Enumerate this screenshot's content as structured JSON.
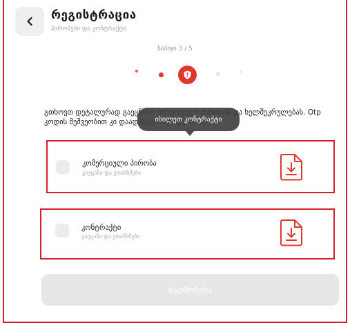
{
  "header": {
    "back_icon": "chevron-left-icon",
    "title": "რეგისტრაცია",
    "subtitle": "პირობები და კონტრაქტი"
  },
  "stepper": {
    "label": "ნაბიჯი 3 / 5",
    "current": 3,
    "total": 5,
    "active_icon": "shield-alert-icon",
    "accent_color": "#e0372d"
  },
  "description": "გთხოვთ დეტალურად გაეცნოთ კომერციულ პირობას და ხელშეკრულებას. Otp კოდის მეშვეობით კი დაადასტუროთ ხელმოწერა.",
  "tooltip": "ისილეთ კონტრაქტი",
  "documents": [
    {
      "title": "კომერციული პირობა",
      "subtitle": "გაეცანი და ეთანხმები",
      "icon": "file-download-icon",
      "checked": false
    },
    {
      "title": "კონტრაქტი",
      "subtitle": "გაეცანი და ეთანხმები",
      "icon": "file-download-icon",
      "checked": false
    }
  ],
  "actions": {
    "sign_label": "ხელმოწერა",
    "sign_enabled": false
  },
  "colors": {
    "accent": "#e0372d",
    "highlight_border": "#d61f2c",
    "disabled_button": "#e7e7e7"
  }
}
